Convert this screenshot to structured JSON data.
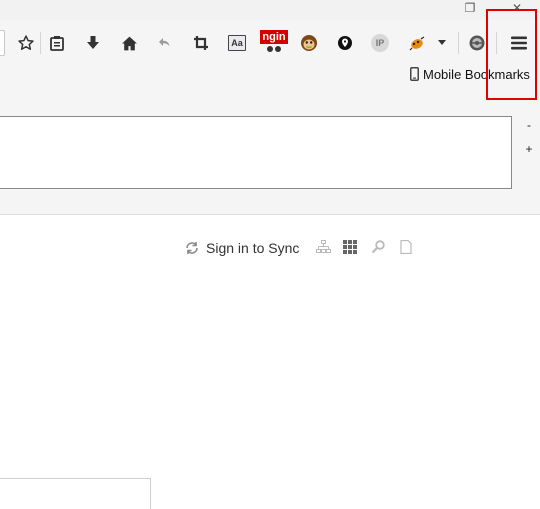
{
  "window": {
    "restore_glyph": "❐",
    "close_glyph": "✕"
  },
  "toolbar": {
    "icons": [
      "bookmark-star-icon",
      "reading-list-icon",
      "download-icon",
      "home-icon",
      "back-arrow-icon",
      "crop-icon",
      "reader-view-icon",
      "nginx-extension-icon",
      "monkey-face-icon",
      "location-pin-icon",
      "ip-lookup-icon",
      "bug-extension-icon",
      "dropdown-arrow-icon",
      "globe-shield-icon",
      "hamburger-menu-icon"
    ],
    "nginx_label": "ngin",
    "ip_label": "IP",
    "reader_label": "Aa",
    "accent_red": "#e00000"
  },
  "bookmarks": {
    "mobile_label": "Mobile Bookmarks"
  },
  "frame": {
    "minus_label": "-",
    "plus_label": "+"
  },
  "library": {
    "sync_label": "Sign in to Sync",
    "icons": [
      "sync-icon",
      "sitemap-icon",
      "grid-icon",
      "search-icon",
      "page-icon"
    ]
  }
}
